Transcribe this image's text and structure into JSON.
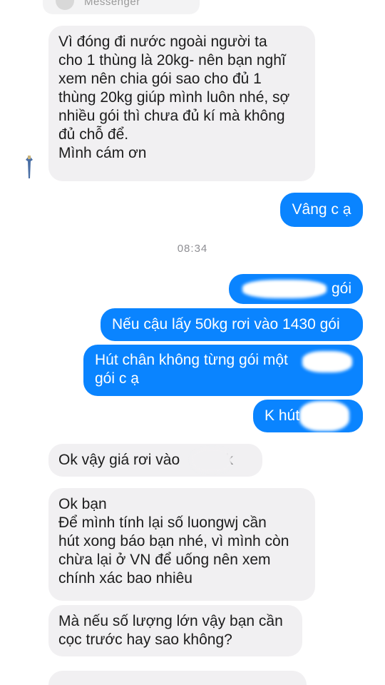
{
  "header": {
    "title": "Messenger"
  },
  "conversation": {
    "timestamp": "08:34",
    "messages": [
      {
        "from": "them",
        "text": "Vì đóng đi nước ngoài người ta\ncho 1 thùng là 20kg- nên bạn nghĩ\nxem nên chia gói sao cho đủ 1\nthùng 20kg giúp mình luôn nhé, sợ\nnhiều gói thì chưa đủ kí mà không\nđủ chỗ để.\nMình cám ơn"
      },
      {
        "from": "me",
        "text": "Vâng c ạ"
      },
      {
        "from": "me",
        "text": "gói"
      },
      {
        "from": "me",
        "text": "Nếu cậu lấy 50kg rơi vào 1430 gói"
      },
      {
        "from": "me",
        "text": "Hút chân không từng gói một\ngói c ạ"
      },
      {
        "from": "me",
        "text": "K hút"
      },
      {
        "from": "them",
        "text": "Ok vậy giá rơi vào         0k"
      },
      {
        "from": "them",
        "text": "Ok bạn\nĐể mình tính lại số luongwj cần\nhút xong báo bạn nhé, vì mình còn\nchừa lại ở VN để uống nên xem\nchính xác bao nhiêu"
      },
      {
        "from": "them",
        "text": "Mà nếu số lượng lớn vậy bạn cần\ncọc trước hay sao không?"
      }
    ]
  },
  "colors": {
    "outgoing_bubble": "#0a84ff",
    "incoming_bubble": "#f1f0f2",
    "timestamp": "#8e8e93"
  },
  "icons": {
    "side_avatar": "avatar-icon"
  }
}
